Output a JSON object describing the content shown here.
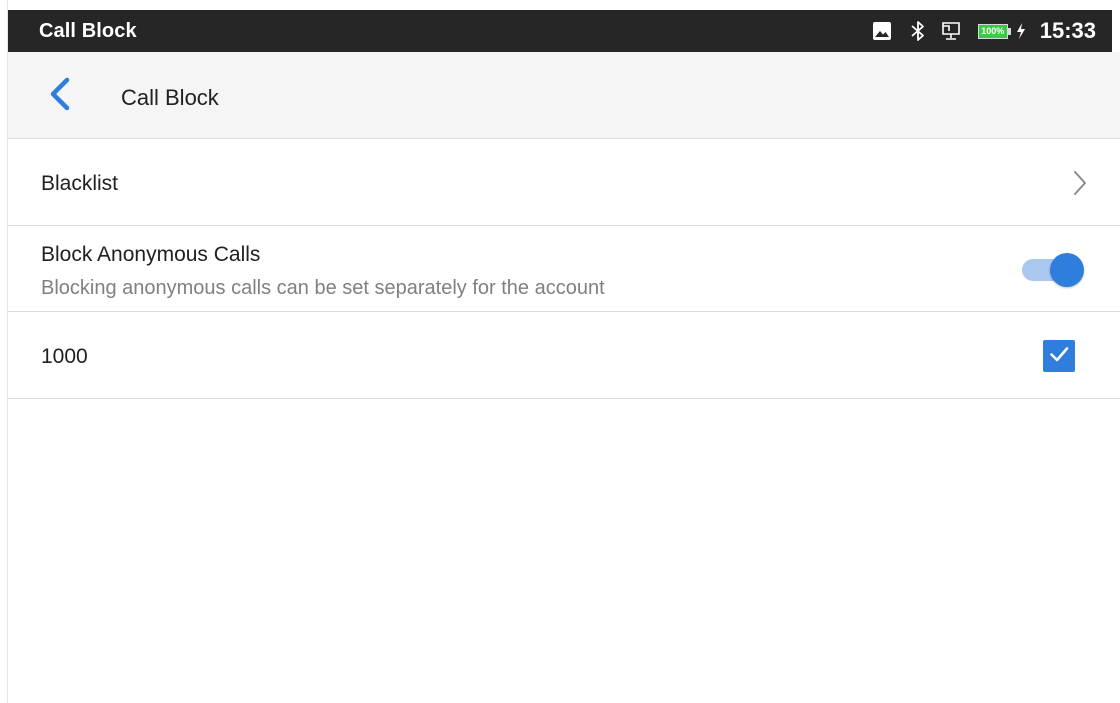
{
  "status_bar": {
    "title": "Call Block",
    "time": "15:33",
    "battery_label": "100%",
    "icons": [
      "image-icon",
      "bluetooth-icon",
      "screen-icon",
      "battery-icon",
      "charging-icon"
    ]
  },
  "app_bar": {
    "title": "Call Block",
    "back_icon": "chevron-left-icon",
    "accent_color": "#2f7ddd"
  },
  "settings": {
    "blacklist": {
      "label": "Blacklist",
      "icon": "chevron-right-icon"
    },
    "block_anonymous": {
      "label": "Block Anonymous Calls",
      "description": "Blocking anonymous calls can be set separately for the account",
      "enabled": true
    },
    "accounts": [
      {
        "label": "1000",
        "checked": true
      }
    ]
  },
  "colors": {
    "status_bar_bg": "#262626",
    "app_bar_bg": "#f5f5f5",
    "accent": "#2f7ddd",
    "toggle_track": "#a9c7ef",
    "battery": "#3ec84a"
  }
}
